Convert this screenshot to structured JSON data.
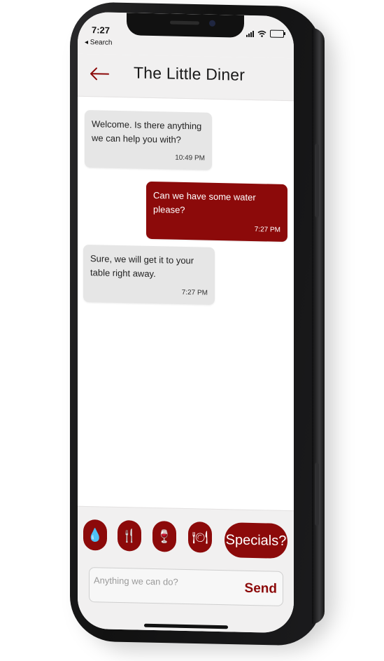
{
  "status": {
    "time": "7:27",
    "back_app": "◂ Search"
  },
  "header": {
    "title": "The Little Diner"
  },
  "messages": [
    {
      "direction": "in",
      "text": "Welcome. Is there anything we can help you with?",
      "time": "10:49 PM"
    },
    {
      "direction": "out",
      "text": "Can we have some water please?",
      "time": "7:27 PM"
    },
    {
      "direction": "in",
      "text": "Sure, we will get it to your table right away.",
      "time": "7:27 PM"
    }
  ],
  "quick_actions": [
    {
      "icon": "water-drop-icon",
      "glyph": "💧"
    },
    {
      "icon": "cutlery-icon",
      "glyph": "🍴"
    },
    {
      "icon": "wine-glass-icon",
      "glyph": "🍷"
    },
    {
      "icon": "plate-icon",
      "glyph": "🍽"
    }
  ],
  "specials_label": "Specials?",
  "composer": {
    "placeholder": "Anything we can do?",
    "send_label": "Send"
  },
  "colors": {
    "accent": "#8c0a0a",
    "bubble_in": "#e6e6e6",
    "bar_bg": "#f1f0f0"
  }
}
